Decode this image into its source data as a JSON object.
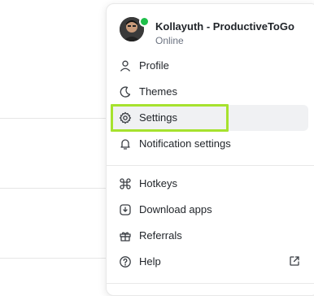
{
  "user": {
    "name": "Kollayuth - ProductiveToGo",
    "status": "Online"
  },
  "menu": {
    "items": [
      {
        "label": "Profile",
        "icon": "user-icon"
      },
      {
        "label": "Themes",
        "icon": "moon-icon"
      },
      {
        "label": "Settings",
        "icon": "gear-icon"
      },
      {
        "label": "Notification settings",
        "icon": "bell-icon"
      },
      {
        "label": "Hotkeys",
        "icon": "command-icon"
      },
      {
        "label": "Download apps",
        "icon": "app-download-icon"
      },
      {
        "label": "Referrals",
        "icon": "gift-icon"
      },
      {
        "label": "Help",
        "icon": "help-icon"
      }
    ]
  },
  "colors": {
    "highlight": "#a6e22e",
    "online": "#1fbf4a",
    "hover": "#f0f1f3"
  }
}
